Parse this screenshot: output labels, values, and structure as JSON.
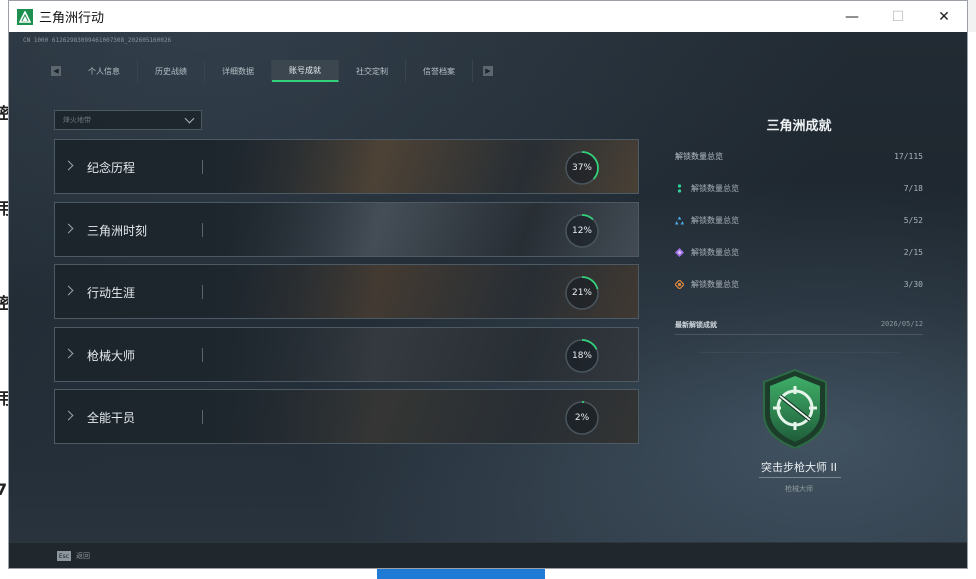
{
  "window": {
    "title": "三角洲行动",
    "controls": {
      "minimize": "—",
      "maximize": "☐",
      "close": "✕"
    }
  },
  "game": {
    "id_code": "CN 1000 612629830994610073​08_202605160026",
    "tabs": [
      {
        "label": "个人信息",
        "active": false
      },
      {
        "label": "历史战绩",
        "active": false
      },
      {
        "label": "详细数据",
        "active": false
      },
      {
        "label": "账号成就",
        "active": true
      },
      {
        "label": "社交定制",
        "active": false
      },
      {
        "label": "信誉档案",
        "active": false
      }
    ],
    "filter": {
      "label": "烽火地带"
    },
    "categories": [
      {
        "name": "纪念历程",
        "percent": 37,
        "percent_label": "37%",
        "theme": "#5a4a38"
      },
      {
        "name": "三角洲时刻",
        "percent": 12,
        "percent_label": "12%",
        "theme": "#4f5862"
      },
      {
        "name": "行动生涯",
        "percent": 21,
        "percent_label": "21%",
        "theme": "#4d4034"
      },
      {
        "name": "枪械大师",
        "percent": 18,
        "percent_label": "18%",
        "theme": "#3a3f44"
      },
      {
        "name": "全能干员",
        "percent": 2,
        "percent_label": "2%",
        "theme": "#3b3a37"
      }
    ],
    "right_panel": {
      "title": "三角洲成就",
      "summary": {
        "label": "解锁数量总览",
        "value": "17/115"
      },
      "rows": [
        {
          "label": "解锁数量总览",
          "value": "7/18",
          "color": "#2fd49a"
        },
        {
          "label": "解锁数量总览",
          "value": "5/52",
          "color": "#4aa8e8"
        },
        {
          "label": "解锁数量总览",
          "value": "2/15",
          "color": "#a272e6"
        },
        {
          "label": "解锁数量总览",
          "value": "3/30",
          "color": "#e08a3c"
        }
      ],
      "recent": {
        "label": "最新解锁成就",
        "date": "2026/05/12"
      },
      "badge": {
        "name": "突击步枪大师 II",
        "category": "枪械大师"
      }
    },
    "footer": {
      "key": "Esc",
      "label": "返回"
    }
  },
  "colors": {
    "accent": "#33d17a",
    "ring_track": "#4a555d"
  }
}
